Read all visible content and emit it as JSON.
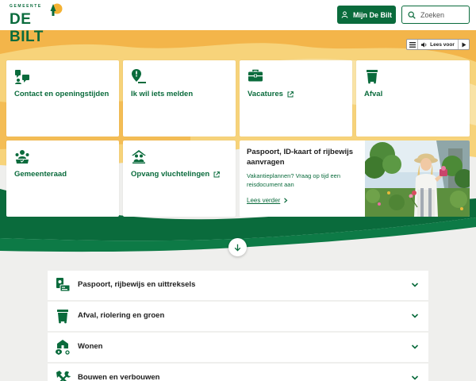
{
  "header": {
    "logo_small": "GEMEENTE",
    "logo_main": "DE BILT",
    "account_button": "Mijn De Bilt",
    "search_placeholder": "Zoeken"
  },
  "readspeaker": {
    "label": "Lees voor"
  },
  "tiles": [
    {
      "label": "Contact en openingstijden",
      "icon": "contact-icon",
      "external": false
    },
    {
      "label": "Ik wil iets melden",
      "icon": "report-location-icon",
      "external": false
    },
    {
      "label": "Vacatures",
      "icon": "briefcase-icon",
      "external": true
    },
    {
      "label": "Afval",
      "icon": "waste-bin-icon",
      "external": false
    },
    {
      "label": "Gemeenteraad",
      "icon": "council-icon",
      "external": false
    },
    {
      "label": "Opvang vluchtelingen",
      "icon": "shelter-icon",
      "external": true
    }
  ],
  "promo": {
    "title": "Paspoort, ID-kaart of rijbewijs aanvragen",
    "text": "Vakantieplannen? Vraag op tijd een reisdocument aan",
    "link": "Lees verder"
  },
  "accordion": [
    {
      "label": "Paspoort, rijbewijs en uittreksels",
      "icon": "id-document-icon"
    },
    {
      "label": "Afval, riolering en groen",
      "icon": "waste-bin-icon"
    },
    {
      "label": "Wonen",
      "icon": "housing-location-icon"
    },
    {
      "label": "Bouwen en verbouwen",
      "icon": "tools-icon"
    }
  ],
  "colors": {
    "brand_green": "#0a6b3c",
    "orange": "#f0a93c",
    "yellow": "#f7cf63",
    "background": "#efefed"
  }
}
